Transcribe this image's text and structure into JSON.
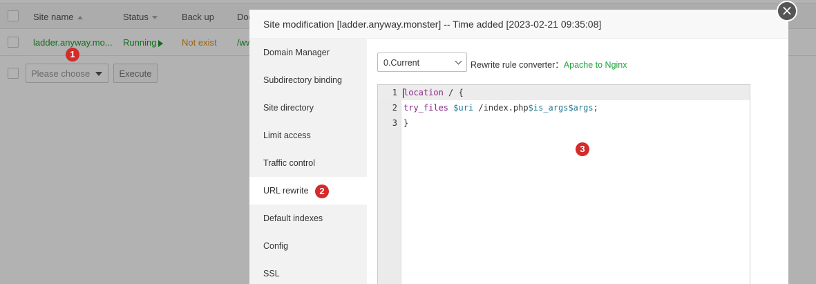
{
  "table": {
    "headers": {
      "site_name": "Site name",
      "status": "Status",
      "backup": "Back up",
      "doc": "Doc"
    },
    "row": {
      "site_name": "ladder.anyway.mo...",
      "status": "Running",
      "backup": "Not exist",
      "path": "/ww"
    }
  },
  "batch": {
    "select_placeholder": "Please choose",
    "execute_label": "Execute"
  },
  "modal": {
    "title": "Site modification [ladder.anyway.monster] -- Time added [2023-02-21 09:35:08]",
    "close_symbol": "×",
    "nav": [
      {
        "label": "Domain Manager"
      },
      {
        "label": "Subdirectory binding"
      },
      {
        "label": "Site directory"
      },
      {
        "label": "Limit access"
      },
      {
        "label": "Traffic control"
      },
      {
        "label": "URL rewrite"
      },
      {
        "label": "Default indexes"
      },
      {
        "label": "Config"
      },
      {
        "label": "SSL"
      }
    ],
    "active_nav": "URL rewrite",
    "version_select": "0.Current",
    "converter_label": "Rewrite rule converter：",
    "converter_link": "Apache to Nginx",
    "editor": {
      "lines": [
        {
          "num": "1",
          "parts": [
            {
              "t": "location",
              "c": "kw"
            },
            {
              "t": " / {",
              "c": ""
            }
          ]
        },
        {
          "num": "2",
          "parts": [
            {
              "t": "try_files",
              "c": "kw"
            },
            {
              "t": " ",
              "c": ""
            },
            {
              "t": "$uri",
              "c": "var"
            },
            {
              "t": " /index.php",
              "c": ""
            },
            {
              "t": "$is_args",
              "c": "var"
            },
            {
              "t": "$args",
              "c": "var"
            },
            {
              "t": ";",
              "c": ""
            }
          ]
        },
        {
          "num": "3",
          "parts": [
            {
              "t": "}",
              "c": ""
            }
          ]
        }
      ]
    }
  },
  "badges": {
    "one": "1",
    "two": "2",
    "three": "3"
  },
  "colors": {
    "badge": "#d42b2b",
    "running": "#1e9c27",
    "not_exist": "#e08f1b",
    "link": "#20a53a",
    "keyword": "#8a2287",
    "variable": "#237893"
  }
}
